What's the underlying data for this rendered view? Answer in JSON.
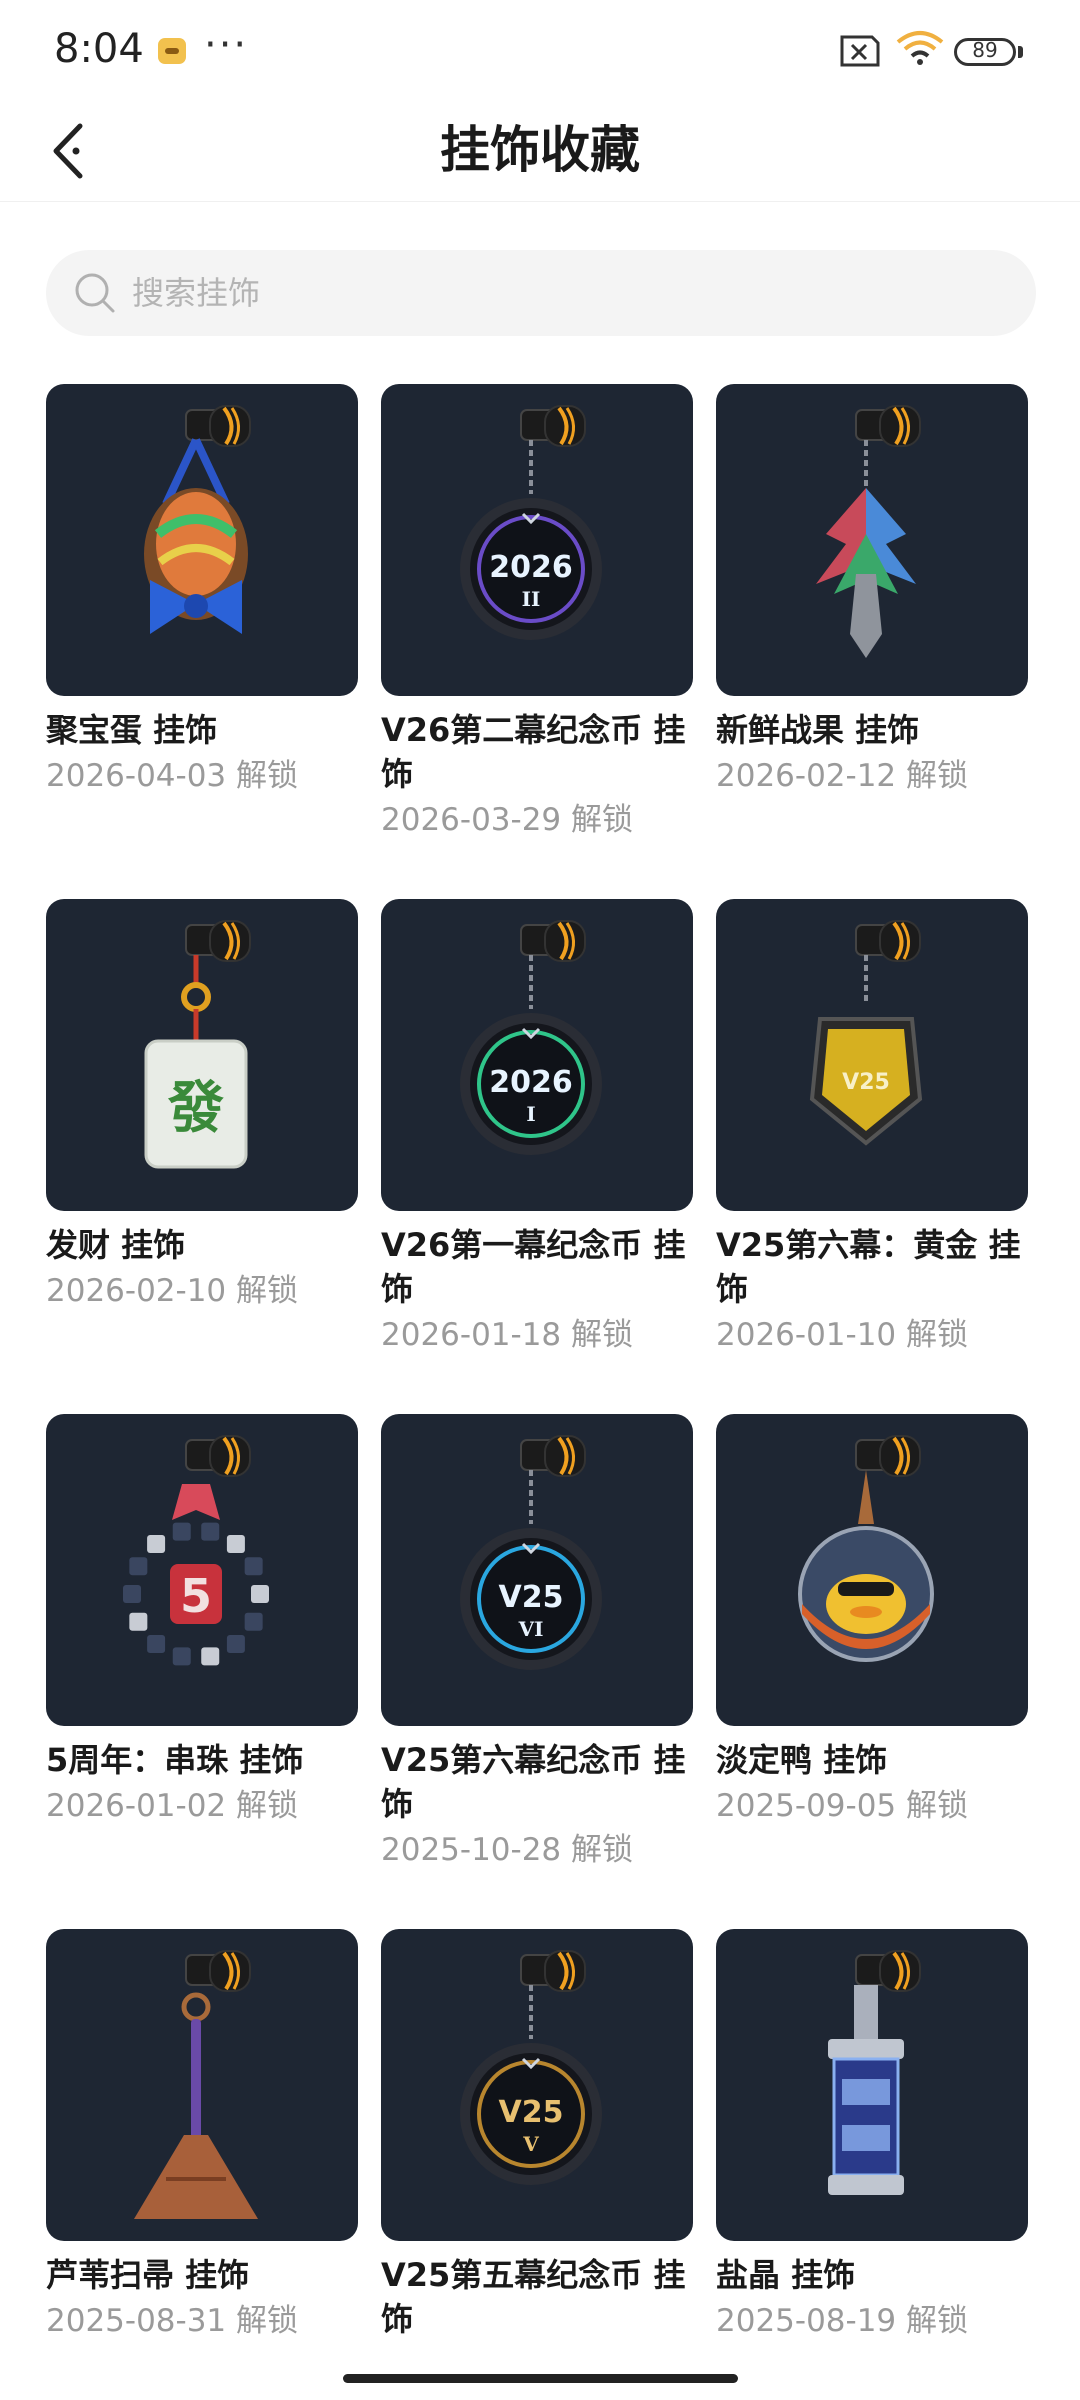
{
  "status_bar": {
    "time": "8:04",
    "more": "···",
    "battery": "89",
    "icons": [
      "app-notification-icon",
      "sim-off-icon",
      "wifi-6-icon",
      "battery-icon"
    ]
  },
  "header": {
    "title": "挂饰收藏",
    "back_icon": "back-arrow-icon"
  },
  "search": {
    "placeholder": "搜索挂饰",
    "value": "",
    "icon": "search-icon"
  },
  "items": [
    {
      "name": "聚宝蛋 挂饰",
      "date": "2026-04-03 解锁",
      "icon": "egg-charm"
    },
    {
      "name": "V26第二幕纪念币 挂饰",
      "date": "2026-03-29 解锁",
      "icon": "coin-charm"
    },
    {
      "name": "新鲜战果 挂饰",
      "date": "2026-02-12 解锁",
      "icon": "leaf-charm"
    },
    {
      "name": "发财 挂饰",
      "date": "2026-02-10 解锁",
      "icon": "mahjong-charm"
    },
    {
      "name": "V26第一幕纪念币 挂饰",
      "date": "2026-01-18 解锁",
      "icon": "coin-charm"
    },
    {
      "name": "V25第六幕：黄金 挂饰",
      "date": "2026-01-10 解锁",
      "icon": "gold-badge-charm"
    },
    {
      "name": "5周年：串珠 挂饰",
      "date": "2026-01-02 解锁",
      "icon": "bead-ring-charm"
    },
    {
      "name": "V25第六幕纪念币 挂饰",
      "date": "2025-10-28 解锁",
      "icon": "coin-charm"
    },
    {
      "name": "淡定鸭 挂饰",
      "date": "2025-09-05 解锁",
      "icon": "duck-capsule-charm"
    },
    {
      "name": "芦苇扫帚 挂饰",
      "date": "2025-08-31 解锁",
      "icon": "broom-charm"
    },
    {
      "name": "V25第五幕纪念币 挂饰",
      "date": "",
      "icon": "coin-charm"
    },
    {
      "name": "盐晶 挂饰",
      "date": "2025-08-19 解锁",
      "icon": "crystal-tube-charm"
    }
  ],
  "coin_labels": {
    "1": {
      "line1": "2026",
      "line2": "II"
    },
    "4": {
      "line1": "2026",
      "line2": "I"
    },
    "7": {
      "line1": "V25",
      "line2": "VI"
    },
    "10": {
      "line1": "V25",
      "line2": "V"
    }
  },
  "badge_label": "V25",
  "mahjong_label": "發",
  "bead_label": "5",
  "colors": {
    "card_bg": "#1e2633",
    "accent_orange": "#f0a020",
    "text_primary": "#1a1a1a",
    "text_secondary": "#9a9a9a",
    "search_bg": "#f4f4f4"
  }
}
